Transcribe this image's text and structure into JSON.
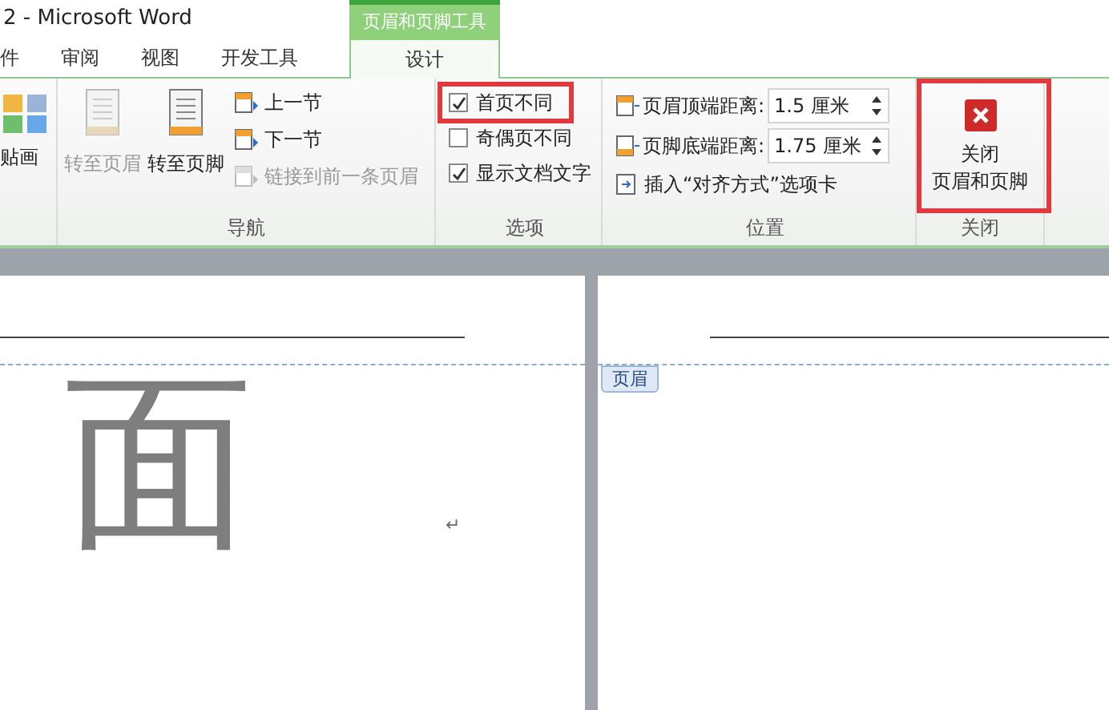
{
  "window": {
    "title": "2 - Microsoft Word",
    "contextual_tab": "页眉和页脚工具"
  },
  "tabs": [
    {
      "label": "件",
      "selected": false
    },
    {
      "label": "审阅",
      "selected": false
    },
    {
      "label": "视图",
      "selected": false
    },
    {
      "label": "开发工具",
      "selected": false
    },
    {
      "label": "设计",
      "selected": true
    }
  ],
  "clip_art": {
    "label": "贴画"
  },
  "navigation": {
    "label": "导航",
    "large_buttons": [
      {
        "label": "转至页眉",
        "disabled": true
      },
      {
        "label": "转至页脚",
        "disabled": false
      }
    ],
    "small_buttons": [
      {
        "label": "上一节",
        "disabled": false
      },
      {
        "label": "下一节",
        "disabled": false
      },
      {
        "label": "链接到前一条页眉",
        "disabled": true
      }
    ]
  },
  "options": {
    "label": "选项",
    "checkboxes": [
      {
        "label": "首页不同",
        "checked": true,
        "highlighted": true
      },
      {
        "label": "奇偶页不同",
        "checked": false,
        "highlighted": false
      },
      {
        "label": "显示文档文字",
        "checked": true,
        "highlighted": false
      }
    ]
  },
  "position": {
    "label": "位置",
    "fields": [
      {
        "label": "页眉顶端距离:",
        "value": "1.5 厘米"
      },
      {
        "label": "页脚底端距离:",
        "value": "1.75 厘米"
      }
    ],
    "insert_tab": "插入“对齐方式”选项卡"
  },
  "close": {
    "label": "关闭",
    "button_lines": [
      "关闭",
      "页眉和页脚"
    ],
    "highlighted": true
  },
  "document": {
    "cover_text": "面",
    "paragraph_mark": "↵",
    "header_tag": "页眉"
  }
}
